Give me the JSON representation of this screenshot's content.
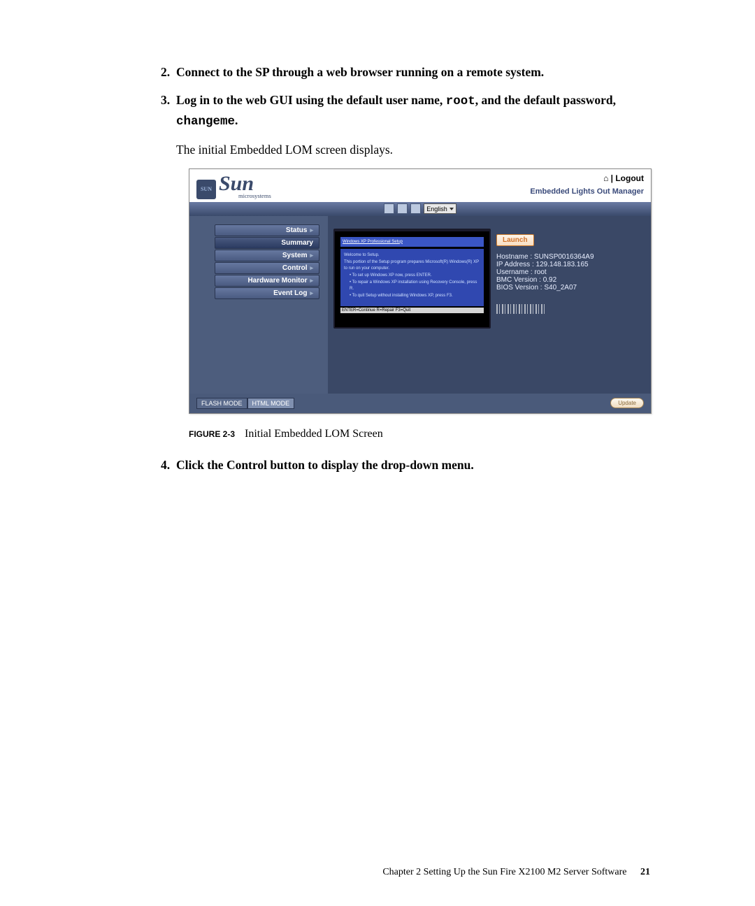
{
  "steps": {
    "s2": {
      "num": "2.",
      "text": "Connect to the SP through a web browser running on a remote system."
    },
    "s3": {
      "num": "3.",
      "pre": "Log in to the web GUI using the default user name, ",
      "user": "root",
      "mid": ", and the default password, ",
      "pass": "changeme",
      "post": ".",
      "sub": "The initial Embedded LOM screen displays."
    },
    "s4": {
      "num": "4.",
      "text": "Click the Control button to display the drop-down menu."
    }
  },
  "screenshot": {
    "logo_brand": "Sun",
    "logo_sub": "microsystems",
    "logout": "⌂  | Logout",
    "subtitle": "Embedded Lights Out Manager",
    "lang": "English",
    "sidebar": {
      "status": "Status",
      "summary": "Summary",
      "system": "System",
      "control": "Control",
      "hwmon": "Hardware Monitor",
      "eventlog": "Event Log"
    },
    "console": {
      "title": "Windows XP Professional Setup",
      "welcome": "Welcome to Setup.",
      "desc": "This portion of the Setup program prepares Microsoft(R) Windows(R) XP to run on your computer.",
      "li1": "To set up Windows XP now, press ENTER.",
      "li2": "To repair a Windows XP installation using Recovery Console, press R.",
      "li3": "To quit Setup without installing Windows XP, press F3.",
      "menu": "ENTER=Continue  R=Repair  F3=Quit"
    },
    "launch": "Launch",
    "info": {
      "hostname": "Hostname : SUNSP0016364A9",
      "ip": "IP Address : 129.148.183.165",
      "user": "Username : root",
      "bmc": "BMC Version : 0.92",
      "bios": "BIOS Version : S40_2A07"
    },
    "modes": {
      "flash": "FLASH MODE",
      "html": "HTML MODE"
    },
    "update": "Update"
  },
  "figure": {
    "label": "FIGURE 2-3",
    "caption": "Initial Embedded LOM Screen"
  },
  "footer": {
    "chapter": "Chapter 2    Setting Up the Sun Fire X2100 M2 Server Software",
    "page": "21"
  }
}
